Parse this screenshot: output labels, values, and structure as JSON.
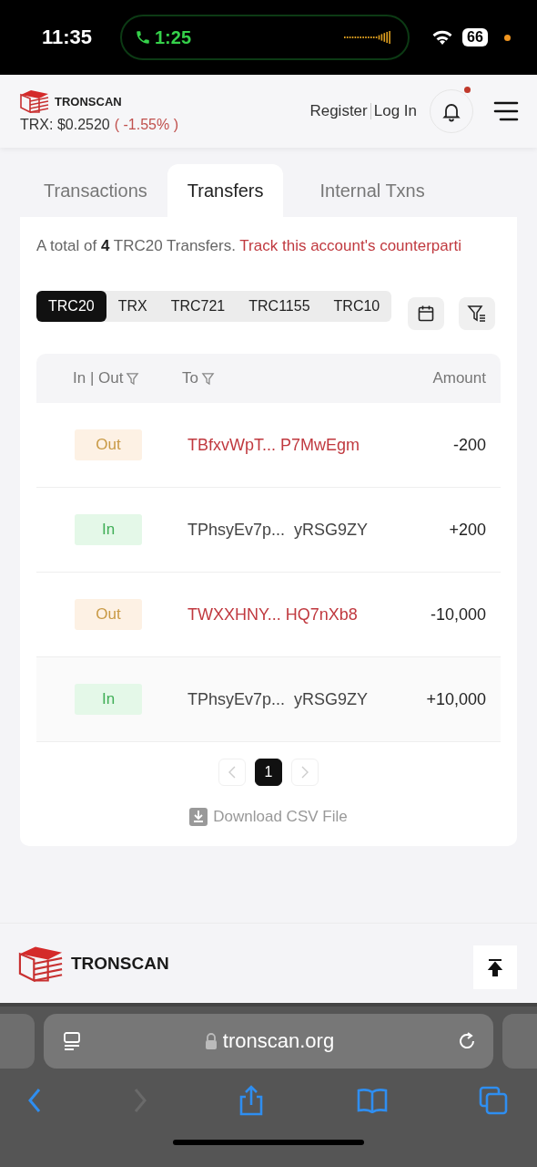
{
  "status_bar": {
    "time": "11:35",
    "call_time": "1:25",
    "battery": "66"
  },
  "header": {
    "logo": "TRONSCAN",
    "price_label": "TRX: $0.2520",
    "price_change": "( -1.55% )",
    "register": "Register",
    "login": "Log In",
    "notification": true
  },
  "tabs": [
    {
      "label": "Transactions",
      "selected": false
    },
    {
      "label": "Transfers",
      "selected": true
    },
    {
      "label": "Internal Txns",
      "selected": false
    }
  ],
  "summary": {
    "text": "A total of **4** TRC20 Transfers.",
    "link": "Track this account's counterparti"
  },
  "token_tabs": [
    {
      "label": "TRC20",
      "selected": true
    },
    {
      "label": "TRX",
      "selected": false
    },
    {
      "label": "TRC721",
      "selected": false
    },
    {
      "label": "TRC1155",
      "selected": false
    },
    {
      "label": "TRC10",
      "selected": false
    }
  ],
  "table": {
    "columns": [
      "In | Out",
      "To",
      "Amount"
    ],
    "rows": [
      {
        "direction": "Out",
        "kind": "out",
        "to": "TBfxvWpT... P7MwEgm",
        "amount": "-200"
      },
      {
        "direction": "In",
        "kind": "in",
        "to": "TPhsyEv7p...  yRSG9ZY",
        "amount": "+200"
      },
      {
        "direction": "Out",
        "kind": "out",
        "to": "TWXXHNY... HQ7nXb8",
        "amount": "-10,000"
      },
      {
        "direction": "In",
        "kind": "in",
        "to": "TPhsyEv7p...  yRSG9ZY",
        "amount": "+10,000"
      }
    ]
  },
  "pagination": {
    "prev_disabled": true,
    "pages": [
      {
        "label": "1",
        "selected": true
      }
    ],
    "next_disabled": true
  },
  "download": "Download CSV File",
  "footer": {
    "logo": "TRONSCAN"
  },
  "browser": {
    "url": "tronscan.org",
    "forward_disabled": true
  }
}
